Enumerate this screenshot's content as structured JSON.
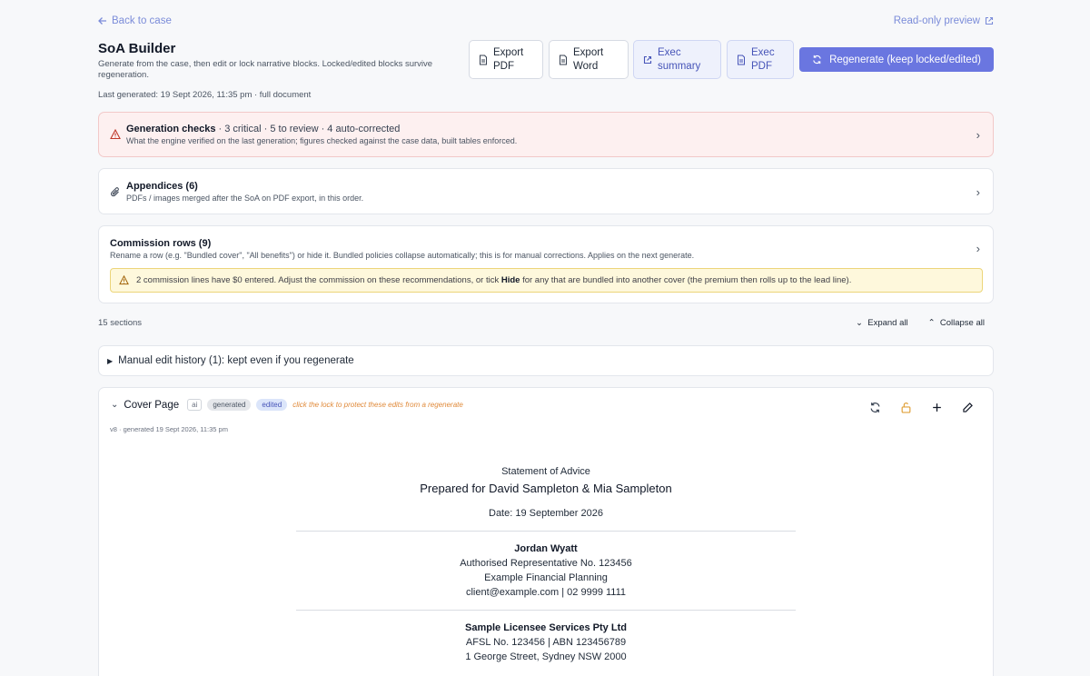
{
  "nav": {
    "back_label": "Back to case",
    "readonly_label": "Read-only preview"
  },
  "header": {
    "title": "SoA Builder",
    "subtitle": "Generate from the case, then edit or lock narrative blocks. Locked/edited blocks survive regeneration.",
    "last_generated": "Last generated: 19 Sept 2026, 11:35 pm · full document"
  },
  "toolbar": {
    "export_pdf": "Export PDF",
    "export_word": "Export Word",
    "exec_summary": "Exec summary",
    "exec_pdf": "Exec PDF",
    "regenerate": "Regenerate (keep locked/edited)"
  },
  "checks": {
    "title": "Generation checks",
    "summary": "· 3 critical · 5 to review · 4 auto-corrected",
    "sub": "What the engine verified on the last generation; figures checked against the case data, built tables enforced."
  },
  "appendices": {
    "title": "Appendices (6)",
    "sub": "PDFs / images merged after the SoA on PDF export, in this order."
  },
  "commission": {
    "title": "Commission rows (9)",
    "sub": "Rename a row (e.g. \"Bundled cover\", \"All benefits\") or hide it. Bundled policies collapse automatically; this is for manual corrections. Applies on the next generate.",
    "warn_pre": "2 commission lines have $0 entered. Adjust the commission on these recommendations, or tick",
    "warn_bold": "Hide",
    "warn_post": "for any that are bundled into another cover (the premium then rolls up to the lead line)."
  },
  "sections": {
    "count": "15 sections",
    "expand": "Expand all",
    "collapse": "Collapse all"
  },
  "history": {
    "label": "Manual edit history (1): kept even if you regenerate"
  },
  "cover": {
    "title": "Cover Page",
    "badge_ai": "ai",
    "badge_generated": "generated",
    "badge_edited": "edited",
    "hint": "click the lock to protect these edits from a regenerate",
    "meta": "v8 · generated 19 Sept 2026, 11:35 pm",
    "doc": {
      "heading": "Statement of Advice",
      "prepared": "Prepared for David Sampleton & Mia Sampleton",
      "date": "Date: 19 September 2026",
      "adviser_name": "Jordan Wyatt",
      "adviser_role": "Authorised Representative No. 123456",
      "practice": "Example Financial Planning",
      "contact": "client@example.com | 02 9999 1111",
      "licensee": "Sample Licensee Services Pty Ltd",
      "afsl": "AFSL No. 123456 | ABN 123456789",
      "address": "1 George Street, Sydney NSW 2000"
    }
  }
}
